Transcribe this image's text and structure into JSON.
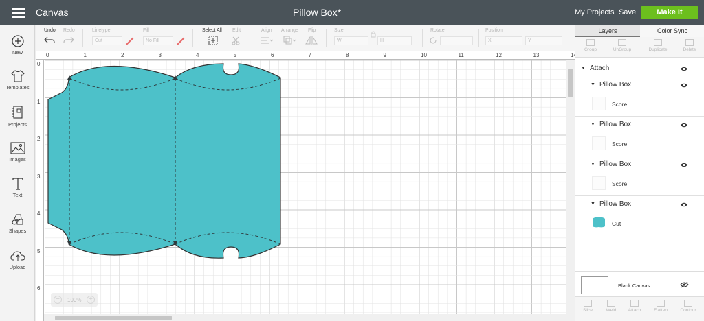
{
  "header": {
    "app_title": "Canvas",
    "doc_title": "Pillow Box*",
    "my_projects": "My Projects",
    "save": "Save",
    "make_it": "Make It"
  },
  "sidebar": {
    "items": [
      {
        "label": "New",
        "icon": "plus-circle-icon"
      },
      {
        "label": "Templates",
        "icon": "shirt-icon"
      },
      {
        "label": "Projects",
        "icon": "notebook-icon"
      },
      {
        "label": "Images",
        "icon": "image-icon"
      },
      {
        "label": "Text",
        "icon": "text-t-icon"
      },
      {
        "label": "Shapes",
        "icon": "shapes-icon"
      },
      {
        "label": "Upload",
        "icon": "upload-cloud-icon"
      }
    ]
  },
  "toolbar": {
    "undo": "Undo",
    "redo": "Redo",
    "linetype": "Linetype",
    "linetype_value": "Cut",
    "fill": "Fill",
    "fill_value": "No Fill",
    "select_all": "Select All",
    "edit": "Edit",
    "align": "Align",
    "arrange": "Arrange",
    "flip": "Flip",
    "size": "Size",
    "w": "W",
    "h": "H",
    "rotate": "Rotate",
    "position": "Position",
    "x": "X",
    "y": "Y"
  },
  "canvas": {
    "ruler_top": [
      "0",
      "1",
      "2",
      "3",
      "4",
      "5",
      "6",
      "7",
      "8",
      "9",
      "10",
      "11",
      "12",
      "13",
      "14"
    ],
    "ruler_left": [
      "0",
      "1",
      "2",
      "3",
      "4",
      "5",
      "6"
    ],
    "zoom_minus": "−",
    "zoom_value": "100%",
    "zoom_plus": "+",
    "shape_color": "#4dc1c9",
    "grid_minor": "#e3e3e3",
    "grid_major": "#c8c8c8"
  },
  "panel": {
    "tabs": [
      "Layers",
      "Color Sync"
    ],
    "tools": [
      "Group",
      "UnGroup",
      "Duplicate",
      "Delete"
    ],
    "attach_label": "Attach",
    "groups": [
      {
        "name": "Pillow Box",
        "child": "Score"
      },
      {
        "name": "Pillow Box",
        "child": "Score"
      },
      {
        "name": "Pillow Box",
        "child": "Score"
      },
      {
        "name": "Pillow Box",
        "child": "Cut"
      }
    ],
    "blank_canvas": "Blank Canvas",
    "bottom_tools": [
      "Slice",
      "Weld",
      "Attach",
      "Flatten",
      "Contour"
    ]
  }
}
